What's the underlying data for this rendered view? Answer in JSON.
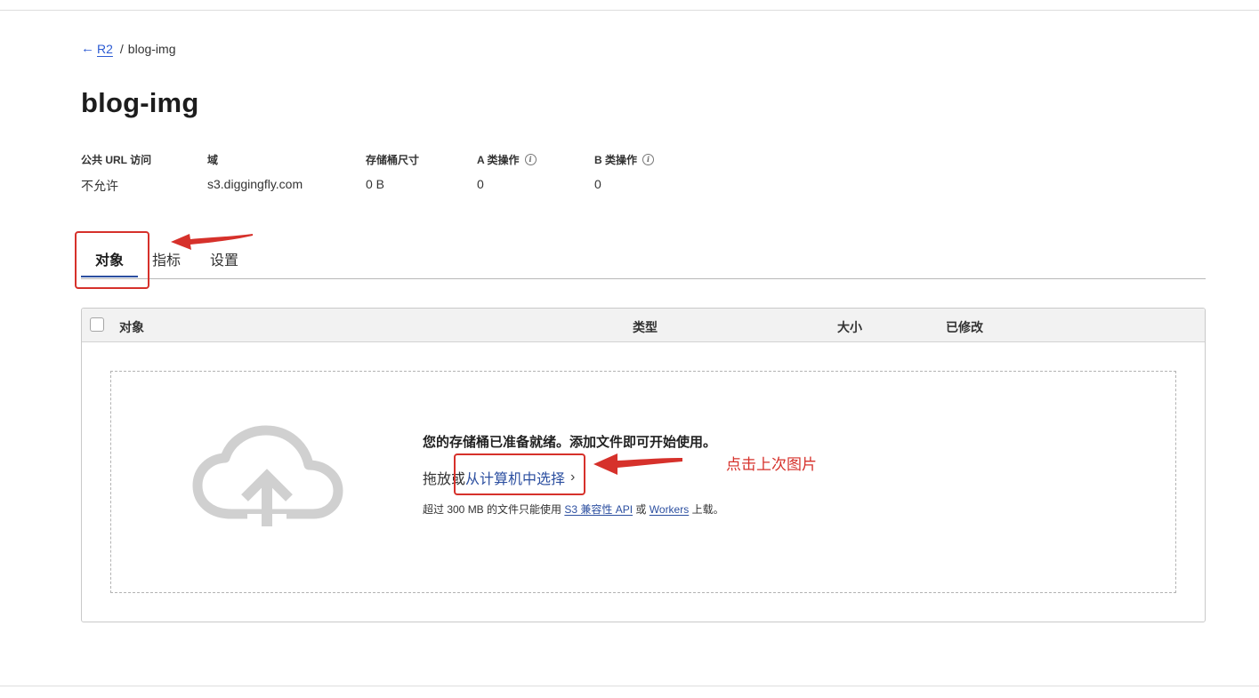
{
  "breadcrumb": {
    "back_icon": "arrow-left-icon",
    "parent": "R2",
    "separator": "/",
    "current": "blog-img"
  },
  "page": {
    "title": "blog-img"
  },
  "stats": {
    "public_url": {
      "label": "公共 URL 访问",
      "value": "不允许"
    },
    "domain": {
      "label": "域",
      "value": "s3.diggingfly.com"
    },
    "bucket_size": {
      "label": "存储桶尺寸",
      "value": "0 B"
    },
    "class_a_ops": {
      "label": "A 类操作",
      "value": "0",
      "info_icon": "info-icon"
    },
    "class_b_ops": {
      "label": "B 类操作",
      "value": "0",
      "info_icon": "info-icon"
    },
    "info_glyph": "i"
  },
  "tabs": {
    "objects": "对象",
    "metrics": "指标",
    "settings": "设置",
    "active": "objects"
  },
  "table": {
    "columns": {
      "object": "对象",
      "type": "类型",
      "size": "大小",
      "modified": "已修改"
    }
  },
  "dropzone": {
    "icon": "cloud-upload-icon",
    "title": "您的存储桶已准备就绪。添加文件即可开始使用。",
    "drag_prefix": "拖放或",
    "choose_link": "从计算机中选择",
    "chevron": "›",
    "note_prefix": "超过 300 MB 的文件只能使用",
    "note_link_s3": "S3 兼容性 API",
    "note_or": "或",
    "note_link_workers": "Workers",
    "note_suffix": "上载。"
  },
  "annotation": {
    "callout_text": "点击上次图片",
    "color": "#d6312b"
  },
  "colors": {
    "link": "#2c4fa0",
    "annotation": "#d6312b"
  }
}
